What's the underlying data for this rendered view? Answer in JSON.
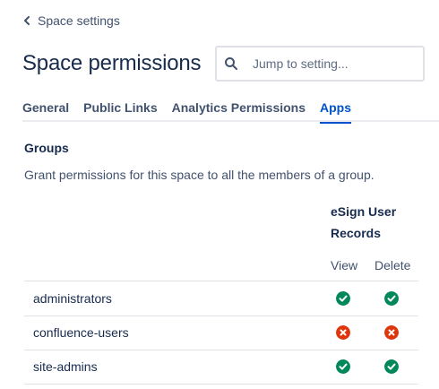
{
  "nav": {
    "back_label": "Space settings"
  },
  "header": {
    "title": "Space permissions"
  },
  "search": {
    "placeholder": "Jump to setting..."
  },
  "tabs": [
    {
      "label": "General",
      "active": false
    },
    {
      "label": "Public Links",
      "active": false
    },
    {
      "label": "Analytics Permissions",
      "active": false
    },
    {
      "label": "Apps",
      "active": true
    }
  ],
  "groups": {
    "heading": "Groups",
    "description": "Grant permissions for this space to all the members of a group.",
    "column_group": "eSign User Records",
    "columns": [
      "View",
      "Delete"
    ],
    "rows": [
      {
        "name": "administrators",
        "view": "granted",
        "delete": "granted"
      },
      {
        "name": "confluence-users",
        "view": "denied",
        "delete": "denied"
      },
      {
        "name": "site-admins",
        "view": "granted",
        "delete": "granted"
      }
    ]
  },
  "colors": {
    "accent": "#0052cc",
    "granted": "#00875a",
    "denied": "#de350b"
  },
  "icons": {
    "granted": "check-circle-icon",
    "denied": "cross-circle-icon"
  }
}
